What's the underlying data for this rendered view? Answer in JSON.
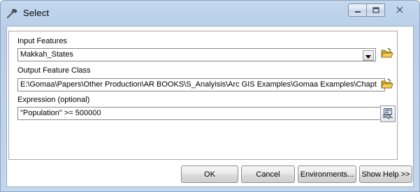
{
  "window": {
    "title": "Select"
  },
  "form": {
    "input_features": {
      "label": "Input Features",
      "value": "Makkah_States"
    },
    "output_feature_class": {
      "label": "Output Feature Class",
      "value": "E:\\Gomaa\\Papers\\Other Production\\AR BOOKS\\S_Analyisis\\Arc GIS Examples\\Gomaa Examples\\Chapt"
    },
    "expression": {
      "label": "Expression (optional)",
      "value": "\"Population\" >= 500000"
    },
    "sql_button_label": "SQL"
  },
  "buttons": {
    "ok": "OK",
    "cancel": "Cancel",
    "environments": "Environments...",
    "show_help": "Show Help >>"
  },
  "colors": {
    "title_bar": "#b9cfe9",
    "folder_icon": "#e8b630"
  }
}
